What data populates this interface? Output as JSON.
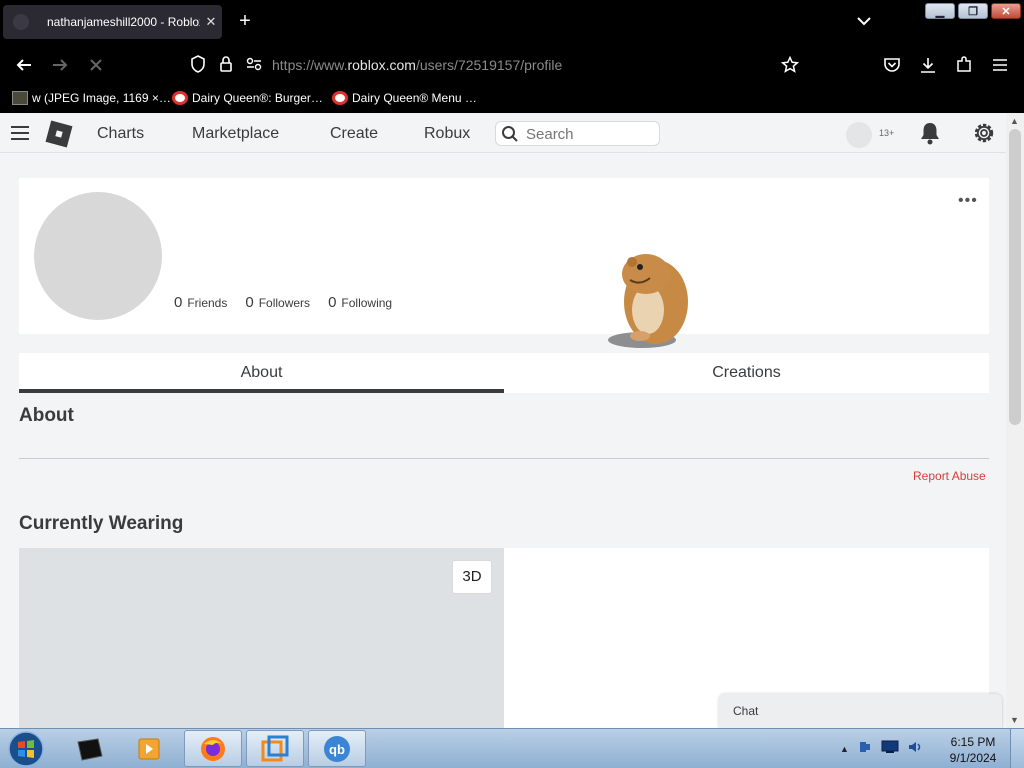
{
  "browser": {
    "tab": {
      "title": "nathanjameshill2000 - Roblox",
      "close": "✕"
    },
    "new_tab": "+",
    "url": {
      "prefix": "https://www.",
      "domain": "roblox.com",
      "path": "/users/72519157/profile"
    },
    "bookmarks": [
      {
        "label": "w (JPEG Image, 1169 ×…"
      },
      {
        "label": "Dairy Queen®: Burger…"
      },
      {
        "label": "Dairy Queen® Menu …"
      }
    ]
  },
  "roblox_header": {
    "nav": [
      "Charts",
      "Marketplace",
      "Create",
      "Robux"
    ],
    "search_placeholder": "Search",
    "age_badge": "13+"
  },
  "profile": {
    "stats": [
      {
        "count": "0",
        "label": "Friends"
      },
      {
        "count": "0",
        "label": "Followers"
      },
      {
        "count": "0",
        "label": "Following"
      }
    ],
    "more": "•••",
    "tabs": [
      {
        "label": "About",
        "active": true
      },
      {
        "label": "Creations",
        "active": false
      }
    ],
    "about_heading": "About",
    "report_abuse": "Report Abuse",
    "wearing_heading": "Currently Wearing",
    "btn_3d": "3D",
    "chat": "Chat"
  },
  "taskbar": {
    "time": "6:15 PM",
    "date": "9/1/2024"
  },
  "colors": {
    "browser_bg": "#000000",
    "page_bg": "#f2f4f5",
    "report_red": "#d43f3a",
    "text": "#393b3d"
  }
}
